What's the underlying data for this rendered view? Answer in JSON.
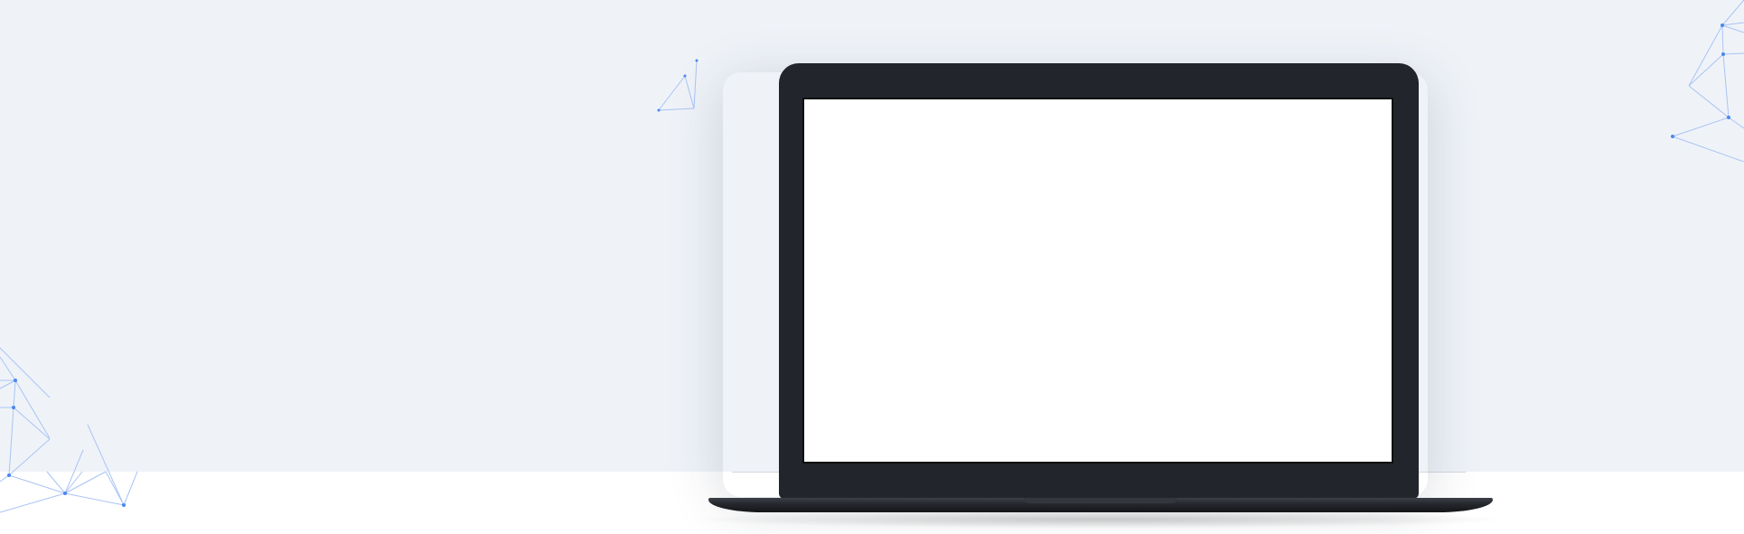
{
  "colors": {
    "backdrop": "#eff3f8",
    "floor": "#ffffff",
    "laptop_body": "#22252b",
    "screen": "#ffffff",
    "network_line": "#a9c4f4",
    "network_node": "#4a86ef"
  },
  "hero": {
    "device": "laptop-icon",
    "screen_content": ""
  },
  "decorations": [
    "network-left",
    "network-top-center",
    "network-top-right"
  ]
}
